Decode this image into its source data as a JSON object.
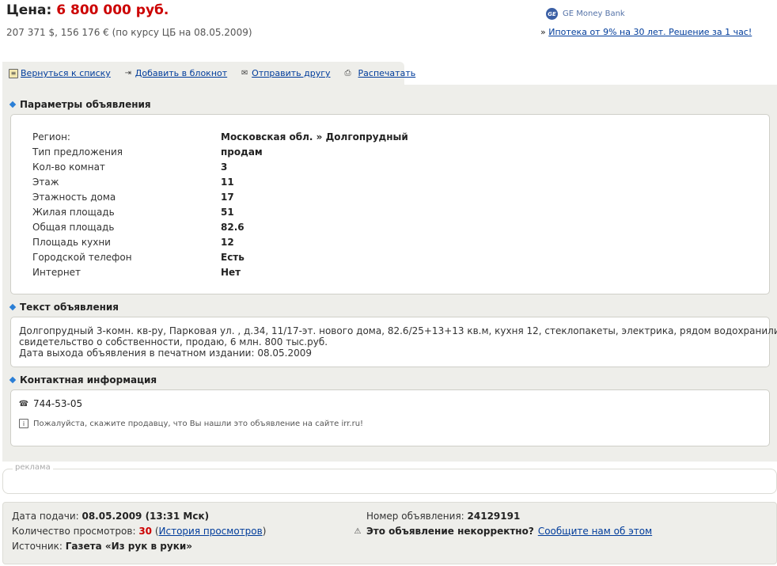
{
  "price": {
    "label": "Цена:",
    "value": "6 800 000 руб.",
    "rate": "207 371 $, 156 176 € (по курсу ЦБ на 08.05.2009)"
  },
  "ad": {
    "logo_text": "GE Money Bank",
    "badge": "GE",
    "link_prefix": "»",
    "link_text": "Ипотека от 9% на 30 лет. Решение за 1 час!"
  },
  "toolbar": {
    "back": "Вернуться к списку",
    "notebook": "Добавить в блокнот",
    "send": "Отправить другу",
    "print": "Распечатать"
  },
  "params": {
    "title": "Параметры объявления",
    "rows": [
      {
        "label": "Регион:",
        "value": "Московская обл. » Долгопрудный"
      },
      {
        "label": "Тип предложения",
        "value": "продам"
      },
      {
        "label": "Кол-во комнат",
        "value": "3"
      },
      {
        "label": "Этаж",
        "value": "11"
      },
      {
        "label": "Этажность дома",
        "value": "17"
      },
      {
        "label": "Жилая площадь",
        "value": "51"
      },
      {
        "label": "Общая площадь",
        "value": "82.6"
      },
      {
        "label": "Площадь кухни",
        "value": "12"
      },
      {
        "label": "Городской телефон",
        "value": "Есть"
      },
      {
        "label": "Интернет",
        "value": "Нет"
      }
    ]
  },
  "ad_text": {
    "title": "Текст объявления",
    "line1": "Долгопрудный 3-комн. кв-ру, Парковая ул. , д.34, 11/17-эт. нового дома, 82.6/25+13+13 кв.м, кухня 12, стеклопакеты, электрика, рядом водохранилище,",
    "line2": "свидетельство о собственности, продаю, 6 млн. 800 тыс.руб.",
    "line3": "Дата выхода объявления в печатном издании: 08.05.2009"
  },
  "contact": {
    "title": "Контактная информация",
    "phone": "744-53-05",
    "hint": "Пожалуйста, скажите продавцу, что Вы нашли это объявление на сайте irr.ru!"
  },
  "reklama_label": "реклама",
  "footer": {
    "date_label": "Дата подачи:",
    "date_value": "08.05.2009 (13:31 Мск)",
    "views_label": "Количество просмотров:",
    "views_value": "30",
    "history_link": "История просмотров",
    "source_label": "Источник:",
    "source_value": "Газета «Из рук в руки»",
    "number_label": "Номер объявления:",
    "number_value": "24129191",
    "incorrect_label": "Это объявление некорректно?",
    "incorrect_link": "Сообщите нам об этом"
  }
}
